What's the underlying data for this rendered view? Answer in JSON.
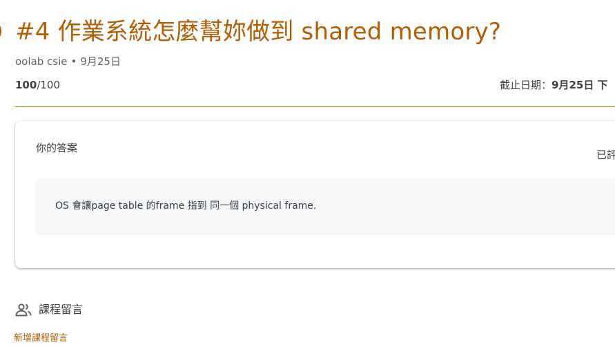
{
  "assignment": {
    "title": "#4 作業系統怎麼幫妳做到 shared memory?",
    "author": "oolab csie",
    "separator": "•",
    "posted_date": "9月25日",
    "points_earned": "100",
    "points_total": "/100",
    "due_label": "截止日期：",
    "due_date": "9月25日 下"
  },
  "answer_card": {
    "title": "你的答案",
    "status": "已評",
    "answer_text": "OS 會讓page table 的frame 指到 同一個 physical frame."
  },
  "comments": {
    "label": "課程留言",
    "icon": "people-icon",
    "add_link": "新增課程留言"
  },
  "colors": {
    "accent": "#b55d00",
    "divider": "#c26401",
    "answer_bg": "#f6f7f9",
    "text": "#3c4043",
    "muted": "#5f6368"
  }
}
